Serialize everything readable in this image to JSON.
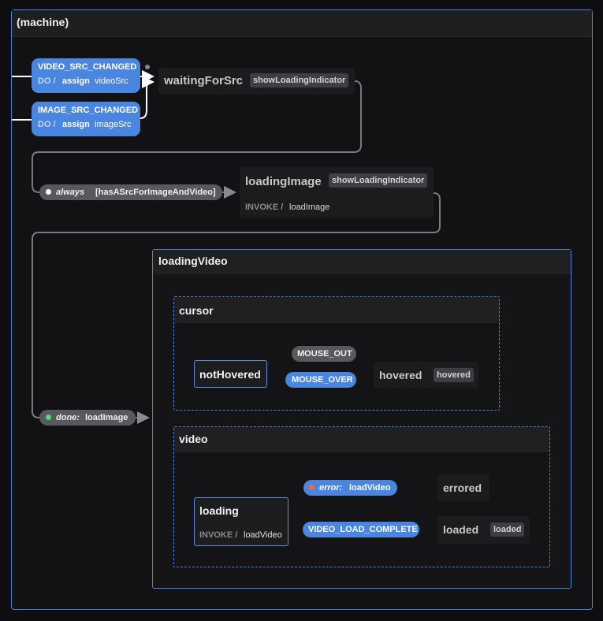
{
  "machine": {
    "title": "(machine)"
  },
  "transitions": {
    "video_src_changed": {
      "event": "VIDEO_SRC_CHANGED",
      "do": "DO /",
      "action_verb": "assign",
      "action_target": "videoSrc"
    },
    "image_src_changed": {
      "event": "IMAGE_SRC_CHANGED",
      "do": "DO /",
      "action_verb": "assign",
      "action_target": "imageSrc"
    },
    "always": {
      "event": "always",
      "guard": "[hasASrcForImageAndVideo]"
    },
    "done": {
      "event": "done:",
      "target": "loadImage"
    },
    "mouse_out": {
      "event": "MOUSE_OUT"
    },
    "mouse_over": {
      "event": "MOUSE_OVER"
    },
    "error": {
      "event": "error:",
      "target": "loadVideo"
    },
    "video_load_complete": {
      "event": "VIDEO_LOAD_COMPLETE"
    }
  },
  "states": {
    "waitingForSrc": {
      "title": "waitingForSrc",
      "tag": "showLoadingIndicator"
    },
    "loadingImage": {
      "title": "loadingImage",
      "tag": "showLoadingIndicator",
      "invoke_label": "INVOKE /",
      "invoke_src": "loadImage"
    },
    "loadingVideo": {
      "title": "loadingVideo"
    },
    "cursor": {
      "title": "cursor"
    },
    "notHovered": {
      "title": "notHovered"
    },
    "hovered": {
      "title": "hovered",
      "tag": "hovered"
    },
    "video": {
      "title": "video"
    },
    "loading": {
      "title": "loading",
      "invoke_label": "INVOKE /",
      "invoke_src": "loadVideo"
    },
    "errored": {
      "title": "errored"
    },
    "loaded": {
      "title": "loaded",
      "tag": "loaded"
    }
  },
  "colors": {
    "accent_blue": "#4a86e0",
    "region_border": "#4b82da",
    "edge": "#7a7a7e",
    "dot_done": "#4ade80",
    "dot_error": "#f26b3a"
  }
}
